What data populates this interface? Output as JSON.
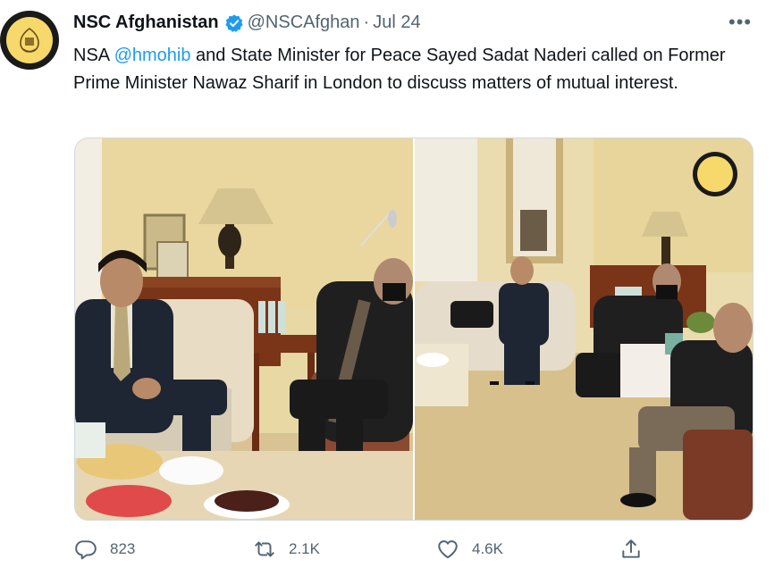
{
  "tweet": {
    "display_name": "NSC Afghanistan",
    "handle": "@NSCAfghan",
    "separator": "·",
    "date": "Jul 24",
    "more_label": "•••",
    "text_before": "NSA ",
    "mention": "@hmohib",
    "text_after": " and State Minister for Peace Sayed Sadat Naderi called on Former Prime Minister Nawaz Sharif in London to discuss matters of mutual interest."
  },
  "actions": {
    "reply_count": "823",
    "retweet_count": "2.1K",
    "like_count": "4.6K"
  },
  "colors": {
    "accent": "#1d9bf0",
    "secondary_text": "#536471",
    "verified_badge": "#1d9bf0"
  },
  "icons": [
    "emblem-avatar-icon",
    "verified-badge-icon",
    "more-icon",
    "reply-icon",
    "retweet-icon",
    "like-icon",
    "share-icon"
  ]
}
